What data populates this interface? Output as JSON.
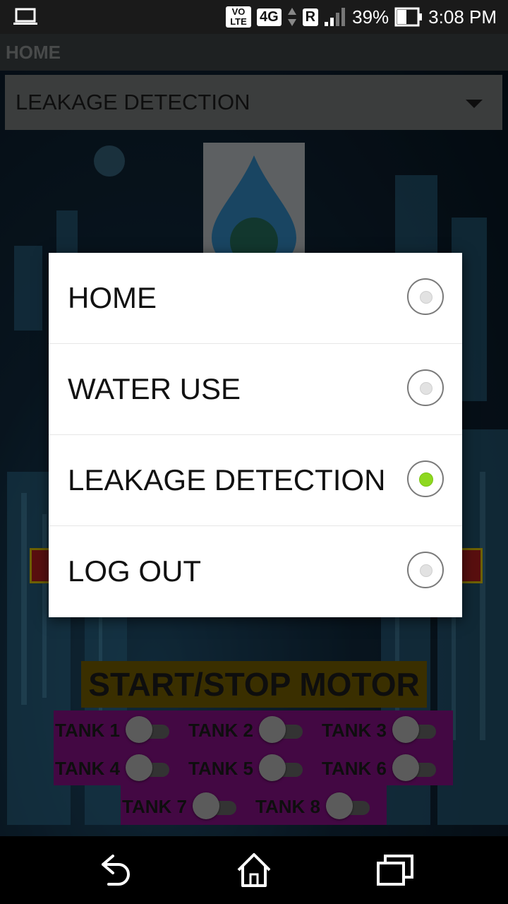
{
  "status_bar": {
    "volte": "VO LTE",
    "network": "4G",
    "roaming": "R",
    "battery": "39%",
    "time": "3:08 PM"
  },
  "toolbar": {
    "title": "HOME"
  },
  "spinner": {
    "selected": "LEAKAGE DETECTION"
  },
  "dialog": {
    "options": [
      {
        "label": "HOME",
        "checked": false
      },
      {
        "label": "WATER USE",
        "checked": false
      },
      {
        "label": "LEAKAGE DETECTION",
        "checked": true
      },
      {
        "label": "LOG OUT",
        "checked": false
      }
    ]
  },
  "motor": {
    "title": "START/STOP MOTOR",
    "tanks": [
      {
        "label": "TANK 1"
      },
      {
        "label": "TANK 2"
      },
      {
        "label": "TANK 3"
      },
      {
        "label": "TANK 4"
      },
      {
        "label": "TANK 5"
      },
      {
        "label": "TANK 6"
      },
      {
        "label": "TANK 7"
      },
      {
        "label": "TANK 8"
      }
    ]
  },
  "colors": {
    "accent_radio": "#8ed81f",
    "motor_title_bg": "#6b5600",
    "tank_bg": "#7a0f7a"
  }
}
